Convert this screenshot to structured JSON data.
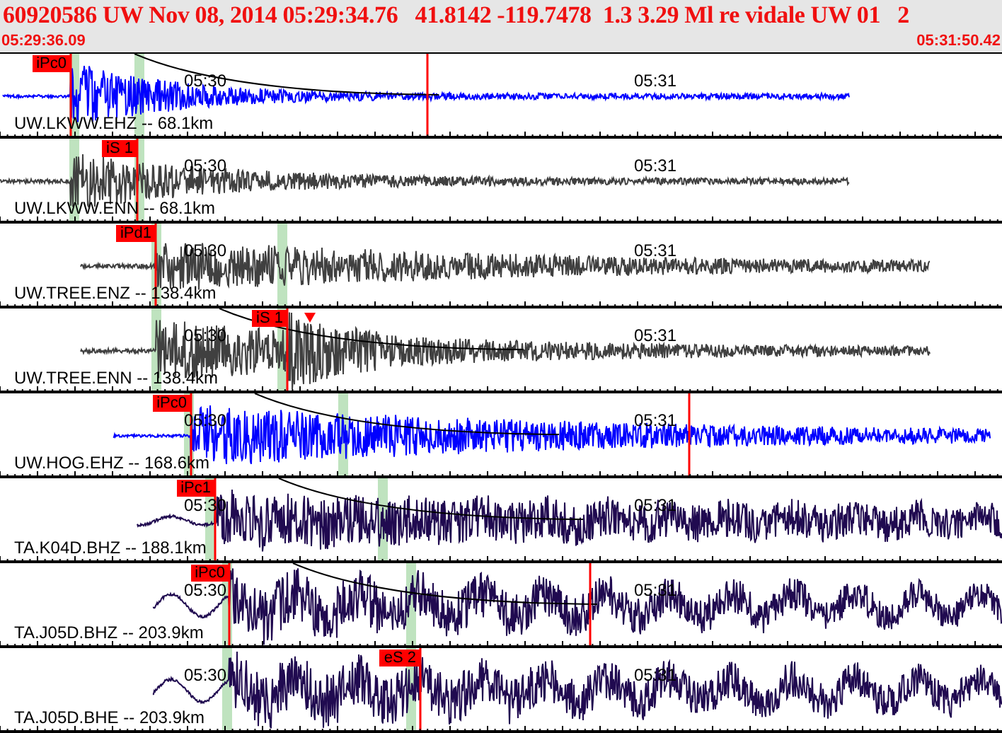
{
  "header": {
    "title": "60920586 UW Nov 08, 2014 05:29:34.76   41.8142 -119.7478  1.3 3.29 Ml re vidale UW 01   2",
    "start_time": "05:29:36.09",
    "end_time": "05:31:50.42"
  },
  "traces": [
    {
      "label": "UW.LKWW.EHZ -- 68.1km",
      "color": "#0000ff",
      "picks": [
        "iPc0"
      ],
      "time_marks": [
        "05:30",
        "05:31"
      ]
    },
    {
      "label": "UW.LKWW.ENN -- 68.1km",
      "color": "#404040",
      "picks": [
        "iS 1"
      ],
      "time_marks": [
        "05:30",
        "05:31"
      ]
    },
    {
      "label": "UW.TREE.ENZ -- 138.4km",
      "color": "#404040",
      "picks": [
        "iPd1"
      ],
      "time_marks": [
        "05:30",
        "05:31"
      ]
    },
    {
      "label": "UW.TREE.ENN -- 138.4km",
      "color": "#404040",
      "picks": [
        "iS 1"
      ],
      "time_marks": [
        "05:30",
        "05:31"
      ]
    },
    {
      "label": "UW.HOG.EHZ -- 168.6km",
      "color": "#0000ff",
      "picks": [
        "iPc0"
      ],
      "time_marks": [
        "05:30",
        "05:31"
      ]
    },
    {
      "label": "TA.K04D.BHZ -- 188.1km",
      "color": "#200a50",
      "picks": [
        "iPc1"
      ],
      "time_marks": [
        "05:30",
        "05:31"
      ]
    },
    {
      "label": "TA.J05D.BHZ -- 203.9km",
      "color": "#200a50",
      "picks": [
        "iPc0"
      ],
      "time_marks": [
        "05:30",
        "05:31"
      ]
    },
    {
      "label": "TA.J05D.BHE -- 203.9km",
      "color": "#200a50",
      "picks": [
        "eS 2"
      ],
      "time_marks": [
        "05:30",
        "05:31"
      ]
    }
  ]
}
